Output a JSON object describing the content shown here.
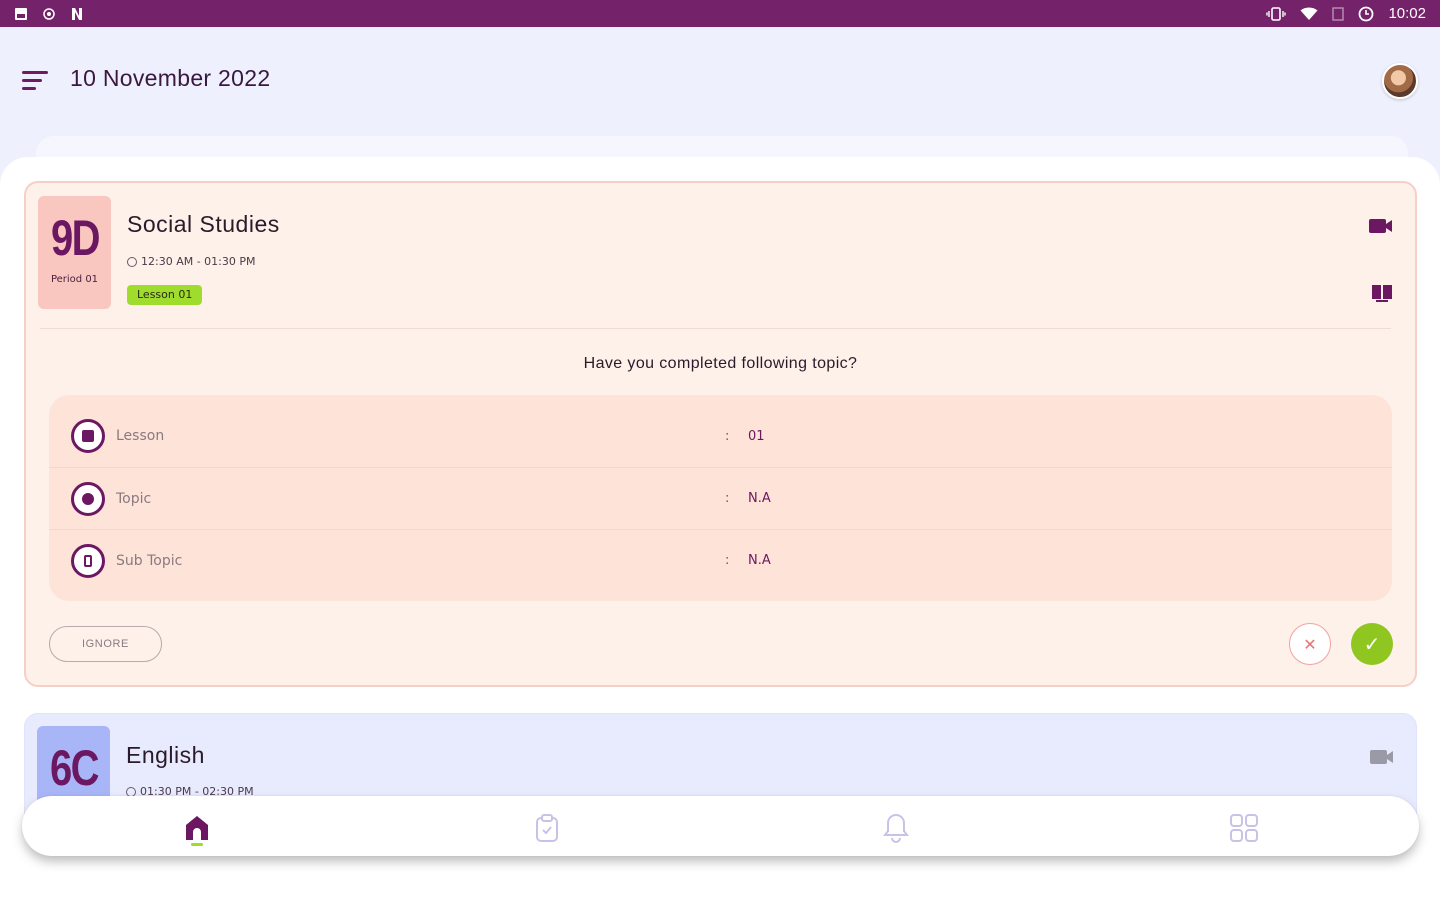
{
  "status_bar": {
    "time": "10:02",
    "left_icons": [
      "image-icon",
      "location-icon",
      "netflix-icon"
    ],
    "right_icons": [
      "vibrate-icon",
      "wifi-icon",
      "signal-icon",
      "alarm-icon"
    ]
  },
  "header": {
    "date": "10 November 2022"
  },
  "cards": [
    {
      "code": "9D",
      "period": "Period 01",
      "subject": "Social Studies",
      "time": "12:30 AM - 01:30 PM",
      "lesson_chip": "Lesson 01",
      "question": "Have you completed following topic?",
      "details": [
        {
          "label": "Lesson",
          "colon": ":",
          "value": "01",
          "icon": "lesson-icon"
        },
        {
          "label": "Topic",
          "colon": ":",
          "value": "N.A",
          "icon": "topic-icon"
        },
        {
          "label": "Sub Topic",
          "colon": ":",
          "value": "N.A",
          "icon": "subtopic-icon"
        }
      ],
      "ignore_label": "IGNORE",
      "reject_glyph": "✕",
      "accept_glyph": "✓"
    },
    {
      "code": "6C",
      "subject": "English",
      "time": "01:30 PM - 02:30 PM"
    }
  ],
  "bottom_nav": [
    {
      "name": "home",
      "icon": "home-icon",
      "active": true
    },
    {
      "name": "assignments",
      "icon": "clipboard-icon",
      "active": false
    },
    {
      "name": "notifications",
      "icon": "bell-icon",
      "active": false
    },
    {
      "name": "more",
      "icon": "grid-icon",
      "active": false
    }
  ],
  "colors": {
    "primary": "#74226a",
    "accent_green": "#9fdc2e",
    "card_bg": "#fdf1ea",
    "card_border": "#f6cfc6",
    "detail_bg": "#fde3d8",
    "badge_red": "#f9c7c0",
    "badge_blue": "#a8b6f7",
    "reject": "#e57373",
    "accept": "#8fc61f"
  }
}
